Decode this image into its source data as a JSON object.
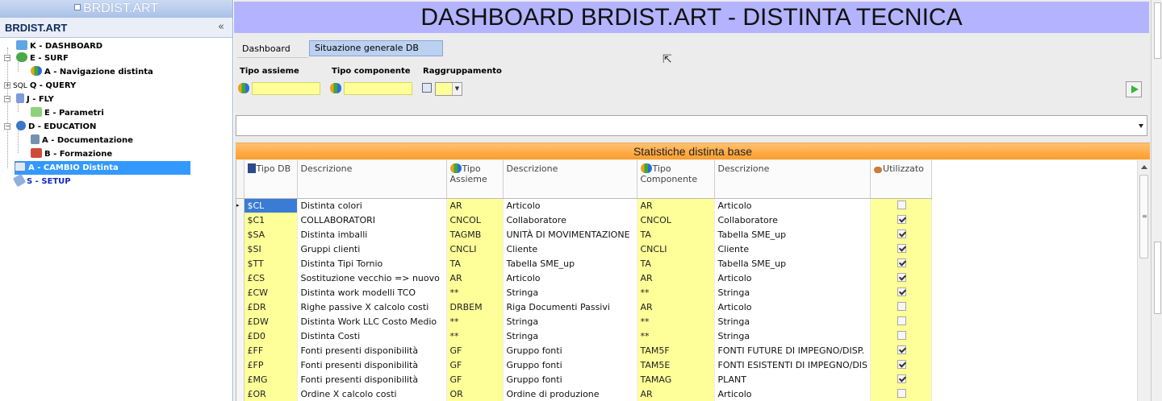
{
  "sidebar": {
    "app_name": "BRDIST.ART",
    "title": "BRDIST.ART",
    "collapse_glyph": "«",
    "items": [
      {
        "label": "K - DASHBOARD",
        "icon": "dashboard-icon"
      },
      {
        "label": "E - SURF",
        "icon": "surf-icon"
      },
      {
        "label": "A - Navigazione distinta",
        "icon": "navigation-icon"
      },
      {
        "label": "Q - QUERY",
        "icon": "sql-icon",
        "icon_text": "SQL"
      },
      {
        "label": "J - FLY",
        "icon": "fly-icon"
      },
      {
        "label": "E - Parametri",
        "icon": "parameters-icon"
      },
      {
        "label": "D - EDUCATION",
        "icon": "info-icon"
      },
      {
        "label": "A - Documentazione",
        "icon": "document-icon"
      },
      {
        "label": "B - Formazione",
        "icon": "training-icon"
      },
      {
        "label": "A - CAMBIO Distinta",
        "icon": "change-icon"
      },
      {
        "label": "S - SETUP",
        "icon": "setup-icon"
      }
    ]
  },
  "header": {
    "title": "DASHBOARD BRDIST.ART - DISTINTA TECNICA"
  },
  "tabs": [
    {
      "label": "Dashboard"
    },
    {
      "label": "Situazione generale DB"
    }
  ],
  "filters": {
    "tipo_assieme": {
      "label": "Tipo assieme",
      "value": ""
    },
    "tipo_componente": {
      "label": "Tipo componente",
      "value": ""
    },
    "raggruppamento": {
      "label": "Raggruppamento",
      "value": ""
    }
  },
  "combo": {
    "value": ""
  },
  "section": {
    "title": "Statistiche distinta base"
  },
  "table": {
    "columns": [
      "Tipo DB",
      "Descrizione",
      "Tipo Assieme",
      "Descrizione",
      "Tipo Componente",
      "Descrizione",
      "Utilizzato"
    ],
    "rows": [
      {
        "tipo_db": "$CL",
        "desc1": "Distinta colori",
        "tipo_assieme": "AR",
        "desc2": "Articolo",
        "tipo_comp": "AR",
        "desc3": "Articolo",
        "utilizzato": false
      },
      {
        "tipo_db": "$C1",
        "desc1": "COLLABORATORI",
        "tipo_assieme": "CNCOL",
        "desc2": "Collaboratore",
        "tipo_comp": "CNCOL",
        "desc3": "Collaboratore",
        "utilizzato": true
      },
      {
        "tipo_db": "$SA",
        "desc1": "Distinta imballi",
        "tipo_assieme": "TAGMB",
        "desc2": "UNITÀ DI MOVIMENTAZIONE",
        "tipo_comp": "TA",
        "desc3": "Tabella SME_up",
        "utilizzato": true
      },
      {
        "tipo_db": "$SI",
        "desc1": "Gruppi clienti",
        "tipo_assieme": "CNCLI",
        "desc2": "Cliente",
        "tipo_comp": "CNCLI",
        "desc3": "Cliente",
        "utilizzato": true
      },
      {
        "tipo_db": "$TT",
        "desc1": "Distinta Tipi Tornio",
        "tipo_assieme": "TA",
        "desc2": "Tabella SME_up",
        "tipo_comp": "TA",
        "desc3": "Tabella SME_up",
        "utilizzato": true
      },
      {
        "tipo_db": "£CS",
        "desc1": "Sostituzione vecchio => nuovo",
        "tipo_assieme": "AR",
        "desc2": "Articolo",
        "tipo_comp": "AR",
        "desc3": "Articolo",
        "utilizzato": true
      },
      {
        "tipo_db": "£CW",
        "desc1": "Distinta work modelli TCO",
        "tipo_assieme": "**",
        "desc2": "Stringa",
        "tipo_comp": "**",
        "desc3": "Stringa",
        "utilizzato": true
      },
      {
        "tipo_db": "£DR",
        "desc1": "Righe passive X calcolo costi",
        "tipo_assieme": "DRBEM",
        "desc2": "Riga Documenti Passivi",
        "tipo_comp": "AR",
        "desc3": "Articolo",
        "utilizzato": false
      },
      {
        "tipo_db": "£DW",
        "desc1": "Distinta Work LLC Costo Medio",
        "tipo_assieme": "**",
        "desc2": "Stringa",
        "tipo_comp": "**",
        "desc3": "Stringa",
        "utilizzato": false
      },
      {
        "tipo_db": "£D0",
        "desc1": "Distinta Costi",
        "tipo_assieme": "**",
        "desc2": "Stringa",
        "tipo_comp": "**",
        "desc3": "Stringa",
        "utilizzato": false
      },
      {
        "tipo_db": "£FF",
        "desc1": "Fonti presenti disponibilità",
        "tipo_assieme": "GF",
        "desc2": "Gruppo fonti",
        "tipo_comp": "TAM5F",
        "desc3": "FONTI FUTURE DI IMPEGNO/DISP.",
        "utilizzato": true
      },
      {
        "tipo_db": "£FP",
        "desc1": "Fonti presenti disponibilità",
        "tipo_assieme": "GF",
        "desc2": "Gruppo fonti",
        "tipo_comp": "TAM5E",
        "desc3": "FONTI ESISTENTI DI IMPEGNO/DIS",
        "utilizzato": true
      },
      {
        "tipo_db": "£MG",
        "desc1": "Fonti presenti disponibilità",
        "tipo_assieme": "GF",
        "desc2": "Gruppo fonti",
        "tipo_comp": "TAMAG",
        "desc3": "PLANT",
        "utilizzato": true
      },
      {
        "tipo_db": "£OR",
        "desc1": "Ordine X calcolo costi",
        "tipo_assieme": "OR",
        "desc2": "Ordine di produzione",
        "tipo_comp": "AR",
        "desc3": "Articolo",
        "utilizzato": false
      }
    ]
  },
  "colors": {
    "banner": "#b3b3ff",
    "input_yellow": "#ffff99",
    "section_orange": "#ffa53a",
    "selection_blue": "#3399ff"
  }
}
